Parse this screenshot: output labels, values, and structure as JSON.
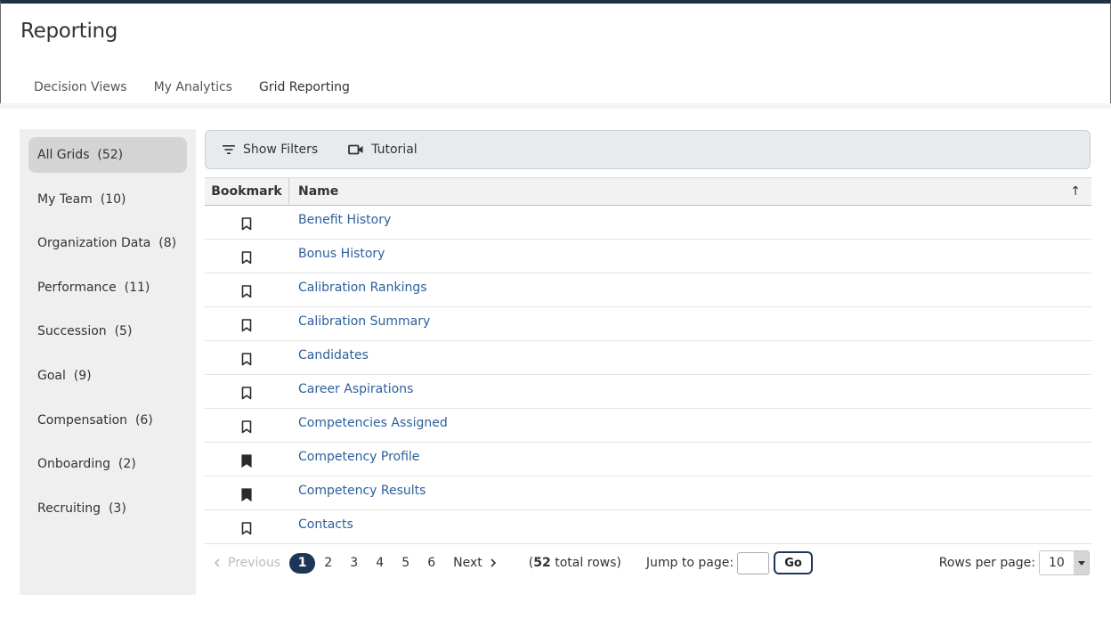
{
  "header": {
    "title": "Reporting"
  },
  "tabs": [
    {
      "label": "Decision Views"
    },
    {
      "label": "My Analytics"
    },
    {
      "label": "Grid Reporting"
    }
  ],
  "sidebar": {
    "items": [
      {
        "label": "All Grids  (52)"
      },
      {
        "label": "My Team  (10)"
      },
      {
        "label": "Organization Data  (8)"
      },
      {
        "label": "Performance  (11)"
      },
      {
        "label": "Succession  (5)"
      },
      {
        "label": "Goal  (9)"
      },
      {
        "label": "Compensation  (6)"
      },
      {
        "label": "Onboarding  (2)"
      },
      {
        "label": "Recruiting  (3)"
      }
    ]
  },
  "toolbar": {
    "show_filters": "Show Filters",
    "tutorial": "Tutorial"
  },
  "grid": {
    "col_bookmark": "Bookmark",
    "col_name": "Name",
    "sort_arrow": "↑",
    "rows": [
      {
        "name": "Benefit History",
        "bookmarked": false
      },
      {
        "name": "Bonus History",
        "bookmarked": false
      },
      {
        "name": "Calibration Rankings",
        "bookmarked": false
      },
      {
        "name": "Calibration Summary",
        "bookmarked": false
      },
      {
        "name": "Candidates",
        "bookmarked": false
      },
      {
        "name": "Career Aspirations",
        "bookmarked": false
      },
      {
        "name": "Competencies Assigned",
        "bookmarked": false
      },
      {
        "name": "Competency Profile",
        "bookmarked": true
      },
      {
        "name": "Competency Results",
        "bookmarked": true
      },
      {
        "name": "Contacts",
        "bookmarked": false
      }
    ]
  },
  "pager": {
    "previous": "Previous",
    "pages": [
      "1",
      "2",
      "3",
      "4",
      "5",
      "6"
    ],
    "current_page": "1",
    "next": "Next",
    "total_open": "(",
    "total_count": "52",
    "total_rest": " total rows)",
    "jump_label": "Jump to page:",
    "jump_value": "",
    "go": "Go",
    "rows_per_page_label": "Rows per page:",
    "rows_per_page_value": "10"
  },
  "colors": {
    "accent": "#1f4f8f",
    "link": "#2d5f9c",
    "active_page": "#1e3656"
  }
}
